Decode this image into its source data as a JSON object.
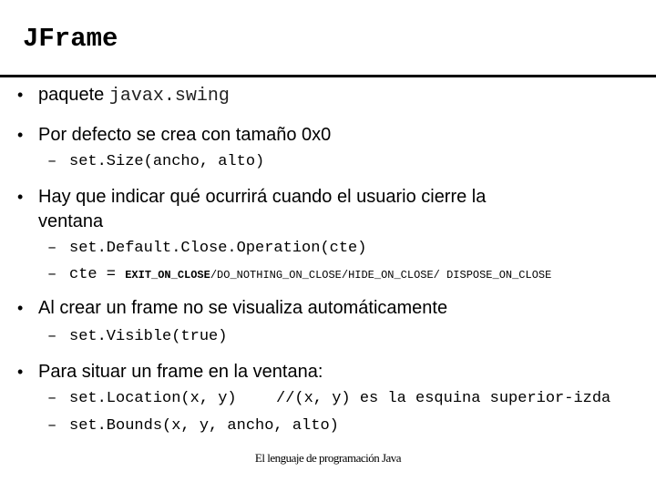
{
  "title": "JFrame",
  "bullets": [
    {
      "text": "paquete ",
      "code": "javax.swing"
    },
    {
      "text": "Por defecto se crea con tamaño 0x0",
      "subs": [
        "set.Size(ancho, alto)"
      ]
    },
    {
      "text1": "Hay que indicar qué ocurrirá cuando el usuario cierre la",
      "text2": "ventana",
      "subs": [
        "set.Default.Close.Operation(cte)"
      ],
      "cte": {
        "prefix": "cte = ",
        "bold": "EXIT_ON_CLOSE",
        "rest": "/DO_NOTHING_ON_CLOSE/HIDE_ON_CLOSE/ DISPOSE_ON_CLOSE"
      }
    },
    {
      "text": "Al crear un frame no se visualiza automáticamente",
      "subs": [
        "set.Visible(true)"
      ]
    },
    {
      "text": "Para situar un frame en la ventana:",
      "subs": [
        "set.Location(x, y)",
        "set.Bounds(x, y, ancho, alto)"
      ],
      "comment": "//(x, y) es la esquina superior-izda"
    }
  ],
  "bullet_glyph": "•",
  "dash_glyph": "–",
  "footer": "El lenguaje de programación Java"
}
